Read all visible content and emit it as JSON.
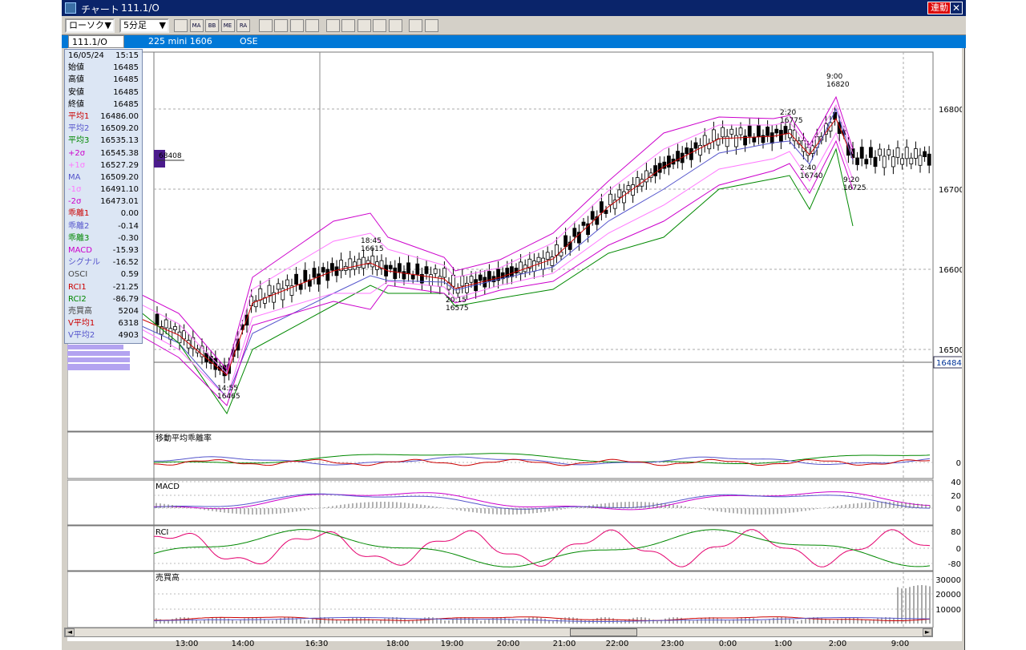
{
  "titlebar": {
    "title": "チャート",
    "symbol": "111.1/O",
    "link_button": "連動",
    "close_label": "✕"
  },
  "toolbar": {
    "chart_type": "ローソク",
    "interval": "5分足",
    "tool_icons": [
      "settings-icon",
      "ma-icon",
      "bb-icon",
      "me-icon",
      "ra-icon",
      "line-chart-icon",
      "candle-icon",
      "trend-icon",
      "zoom-icon",
      "draw-icon",
      "fib-icon",
      "pen-icon",
      "cursor-icon",
      "eraser-icon",
      "search-icon",
      "gann-icon"
    ],
    "tool_labels": [
      "",
      "MA",
      "BB",
      "ME",
      "RA",
      "",
      "",
      "",
      "",
      "",
      "",
      "",
      "",
      "",
      "",
      ""
    ]
  },
  "infobar": {
    "symbol": "111.1/O",
    "description": "225 mini 1606",
    "exchange": "OSE"
  },
  "data_panel": {
    "date": "16/05/24",
    "time": "15:15",
    "rows": [
      {
        "k": "始値",
        "v": "16485",
        "c": "#000000"
      },
      {
        "k": "高値",
        "v": "16485",
        "c": "#000000"
      },
      {
        "k": "安値",
        "v": "16485",
        "c": "#000000"
      },
      {
        "k": "終値",
        "v": "16485",
        "c": "#000000"
      },
      {
        "k": "平均1",
        "v": "16486.00",
        "c": "#cc0000"
      },
      {
        "k": "平均2",
        "v": "16509.20",
        "c": "#5555cc"
      },
      {
        "k": "平均3",
        "v": "16535.13",
        "c": "#008800"
      },
      {
        "k": "+2σ",
        "v": "16545.38",
        "c": "#cc00cc"
      },
      {
        "k": "+1σ",
        "v": "16527.29",
        "c": "#ff77ff"
      },
      {
        "k": "MA",
        "v": "16509.20",
        "c": "#5555cc"
      },
      {
        "k": "-1σ",
        "v": "16491.10",
        "c": "#ff77ff"
      },
      {
        "k": "-2σ",
        "v": "16473.01",
        "c": "#cc00cc"
      },
      {
        "k": "乖離1",
        "v": "0.00",
        "c": "#cc0000"
      },
      {
        "k": "乖離2",
        "v": "-0.14",
        "c": "#5555cc"
      },
      {
        "k": "乖離3",
        "v": "-0.30",
        "c": "#008800"
      },
      {
        "k": "MACD",
        "v": "-15.93",
        "c": "#cc00cc"
      },
      {
        "k": "シグナル",
        "v": "-16.52",
        "c": "#5555cc"
      },
      {
        "k": "OSCI",
        "v": "0.59",
        "c": "#444444"
      },
      {
        "k": "RCI1",
        "v": "-21.25",
        "c": "#cc0000"
      },
      {
        "k": "RCI2",
        "v": "-86.79",
        "c": "#008800"
      },
      {
        "k": "売買高",
        "v": "5204",
        "c": "#444444"
      },
      {
        "k": "V平均1",
        "v": "6318",
        "c": "#cc0000"
      },
      {
        "k": "V平均2",
        "v": "4903",
        "c": "#5555cc"
      }
    ]
  },
  "price_axis": [
    "16800",
    "16700",
    "16600",
    "16500"
  ],
  "current_price": "16484",
  "volume_profile_label": "68408",
  "annotations": [
    {
      "time": "14:55",
      "price": "16465"
    },
    {
      "time": "18:45",
      "price": "16615"
    },
    {
      "time": "20:15",
      "price": "16575"
    },
    {
      "time": "2:20",
      "price": "16775"
    },
    {
      "time": "2:40",
      "price": "16740"
    },
    {
      "time": "9:00",
      "price": "16820"
    },
    {
      "time": "9:20",
      "price": "16725"
    }
  ],
  "panels": {
    "deviation": {
      "title": "移動平均乖離率",
      "axis": [
        "0"
      ]
    },
    "macd": {
      "title": "MACD",
      "axis": [
        "40",
        "20",
        "0"
      ]
    },
    "rci": {
      "title": "RCI",
      "axis": [
        "80",
        "0",
        "-80"
      ]
    },
    "volume": {
      "title": "売買高",
      "axis": [
        "30000",
        "20000",
        "10000"
      ]
    }
  },
  "time_axis": [
    "13:00",
    "14:00",
    "16:30",
    "18:00",
    "19:00",
    "20:00",
    "21:00",
    "22:00",
    "23:00",
    "0:00",
    "1:00",
    "2:00",
    "9:00"
  ],
  "chart_data": {
    "type": "line",
    "title": "",
    "x": [
      "13:00",
      "14:00",
      "14:55",
      "16:30",
      "18:00",
      "18:45",
      "19:00",
      "20:00",
      "20:15",
      "21:00",
      "22:00",
      "23:00",
      "0:00",
      "1:00",
      "2:00",
      "2:20",
      "2:40",
      "9:00",
      "9:20"
    ],
    "series": [
      {
        "name": "終値",
        "values": [
          16550,
          16520,
          16470,
          16560,
          16600,
          16610,
          16600,
          16590,
          16578,
          16592,
          16615,
          16680,
          16730,
          16765,
          16768,
          16772,
          16745,
          16790,
          16740
        ]
      }
    ],
    "ylim": [
      16420,
      16870
    ],
    "xlabel": "",
    "ylabel": ""
  }
}
